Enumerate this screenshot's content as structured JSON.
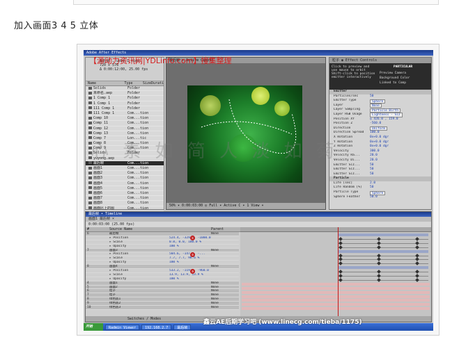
{
  "page": {
    "heading": "加入画面3 4 5 立体"
  },
  "app": {
    "window_title": "Adobe After Effects",
    "watermark_top": "【源动力资讯网|YDLinfo.com】搜集整理",
    "watermark_center": "心 素 如 简  人 淡 如 菊",
    "watermark_bottom": "鑫云AE后期学习吧 (www.linecg.com/tieba/1175)"
  },
  "project": {
    "info_lines": [
      "最后帧 , used 1 time",
      "720 x 576",
      "Δ 0:00:12:00, 25.00 fps"
    ],
    "columns": [
      "Name",
      "Type",
      "Size",
      "Durati"
    ],
    "items": [
      {
        "name": "Solids",
        "type": "Folder"
      },
      {
        "name": "未命名.aep",
        "type": "Folder"
      },
      {
        "name": "1 Comp 1",
        "type": "Folder"
      },
      {
        "name": "1 Comp 1",
        "type": "Folder"
      },
      {
        "name": "111 Comp 1",
        "type": "Folder"
      },
      {
        "name": "111 Comp 1",
        "type": "Com...tion"
      },
      {
        "name": "Comp 10",
        "type": "Com...tion"
      },
      {
        "name": "Comp 11",
        "type": "Com...tion"
      },
      {
        "name": "Comp 12",
        "type": "Com...tion"
      },
      {
        "name": "Comp 13",
        "type": "Com...tion"
      },
      {
        "name": "Comp 7",
        "type": "Lon...tic"
      },
      {
        "name": "Comp 8",
        "type": "Com...tion"
      },
      {
        "name": "Comp 9",
        "type": "Com...tion"
      },
      {
        "name": "Solids",
        "type": "Folder"
      },
      {
        "name": "yuyong.aep",
        "type": ""
      },
      {
        "name": "最后帧",
        "type": "Com...tion",
        "selected": true
      },
      {
        "name": "画面1",
        "type": "Com...tion"
      },
      {
        "name": "画面2",
        "type": "Com...tion"
      },
      {
        "name": "画面3",
        "type": "Com...tion"
      },
      {
        "name": "画面4",
        "type": "Com...tion"
      },
      {
        "name": "画面5",
        "type": "Com...tion"
      },
      {
        "name": "画面6",
        "type": "Com...tion"
      },
      {
        "name": "画面7",
        "type": "Com...tion"
      },
      {
        "name": "画面8",
        "type": "Com...tion"
      },
      {
        "name": "画面比上的图",
        "type": "Com...tion"
      },
      {
        "name": "绿色...bar4459",
        "type": "Vid...avis"
      }
    ]
  },
  "composition": {
    "tab": "最后帧 × Active Camera",
    "footer": "50%  ▾  0:00:03:00  ◎  Full  ▾  Active C  ▾  1 View  ▾"
  },
  "effect_controls": {
    "tab": "粒子  ◉ Effect Controls",
    "banner_text": [
      "Click to preview and",
      "use mouse to orbit",
      "Shift-click to position",
      "emitter interactively"
    ],
    "banner_options": [
      "Preview Camera",
      "Background Color",
      "Linked to Comp"
    ],
    "brand": "PARTICULAR",
    "sections": [
      {
        "label": "Emitter",
        "section": true
      },
      {
        "label": "Particles/sec",
        "value": "50"
      },
      {
        "label": "Emitter Type",
        "value": "Sphere",
        "box": true
      },
      {
        "label": "Layer",
        "value": "None",
        "box": true
      },
      {
        "label": "Layer Sampling",
        "value": "Particle Birth",
        "box": true
      },
      {
        "label": "Layer RGB Usage",
        "value": "Lightness - Siz",
        "box": true
      },
      {
        "label": "Position XY",
        "value": "◎ 426.0 , 159.0"
      },
      {
        "label": "Position Z",
        "value": "-560.0"
      },
      {
        "label": "Direction",
        "value": "Uniform",
        "box": true
      },
      {
        "label": "Direction Spread",
        "value": "100.0"
      },
      {
        "label": "X Rotation",
        "value": "0x+0.0 dgr"
      },
      {
        "label": "Y Rotation",
        "value": "0x+0.0 dgr"
      },
      {
        "label": "Z Rotation",
        "value": "0x+0.0 dgr"
      },
      {
        "label": "Velocity",
        "value": "300.0"
      },
      {
        "label": "Velocity Ra...",
        "value": "20.0"
      },
      {
        "label": "Velocity Di...",
        "value": "20.0"
      },
      {
        "label": "Emitter Siz...",
        "value": "50"
      },
      {
        "label": "Emitter Siz...",
        "value": "50"
      },
      {
        "label": "Emitter Siz...",
        "value": "50"
      },
      {
        "label": "Particle",
        "section": true
      },
      {
        "label": "Life [sec]",
        "value": "2.0"
      },
      {
        "label": "Life Random [%]",
        "value": "50"
      },
      {
        "label": "Particle Type",
        "value": "Sphere",
        "box": true
      },
      {
        "label": "Sphere Feather",
        "value": "50.0"
      }
    ]
  },
  "timeline": {
    "title": "最后帧 • Timeline",
    "tabs": "画面1  最后帧 ×",
    "time_display": "0:00:03:00 (25.00 fps)",
    "columns": [
      "#",
      "Source Name",
      "",
      "Parent"
    ],
    "rows": [
      {
        "idx": "6",
        "src": "最后帧",
        "val": "",
        "par": "None",
        "layer": true
      },
      {
        "idx": "",
        "src": "▸ Position",
        "val": "524.4, -329.0, -1000.0",
        "par": ""
      },
      {
        "idx": "",
        "src": "▸ Scale",
        "val": "0.0, 0.0, 100.0 %",
        "par": ""
      },
      {
        "idx": "",
        "src": "▸ Opacity",
        "val": "100 %",
        "par": ""
      },
      {
        "idx": "7",
        "src": "画面3",
        "val": "",
        "par": "None",
        "layer": true
      },
      {
        "idx": "",
        "src": "▸ Position",
        "val": "504.6, -147.1, -...",
        "par": ""
      },
      {
        "idx": "",
        "src": "▸ Scale",
        "val": "7.7, 7.7, 98.6 %",
        "par": ""
      },
      {
        "idx": "",
        "src": "▸ Opacity",
        "val": "100 %",
        "par": ""
      },
      {
        "idx": "8",
        "src": "画面4",
        "val": "",
        "par": "None",
        "layer": true
      },
      {
        "idx": "",
        "src": "▸ Position",
        "val": "533.2, -119.5, -960.0",
        "par": ""
      },
      {
        "idx": "",
        "src": "▸ Scale",
        "val": "13.9, 13.9, 13.9 %",
        "par": ""
      },
      {
        "idx": "",
        "src": "▸ Opacity",
        "val": "100 %",
        "par": ""
      },
      {
        "idx": "4",
        "src": "画面1",
        "val": "",
        "par": "None",
        "layer": true
      },
      {
        "idx": "5",
        "src": "画面2",
        "val": "",
        "par": "None",
        "layer": true
      },
      {
        "idx": "6",
        "src": "粒子",
        "val": "",
        "par": "None",
        "layer": true
      },
      {
        "idx": "7",
        "src": "粒子",
        "val": "",
        "par": "None",
        "layer": true
      },
      {
        "idx": "8",
        "src": "绿色底1",
        "val": "",
        "par": "None",
        "layer": true
      },
      {
        "idx": "9",
        "src": "绿色底2",
        "val": "",
        "par": "None",
        "layer": true
      },
      {
        "idx": "10",
        "src": "绿色底3",
        "val": "",
        "par": "None",
        "layer": true
      }
    ],
    "footer": "Switches / Modes",
    "marker_labels": [
      "①",
      "②",
      "③"
    ]
  },
  "taskbar": {
    "start": "开始",
    "tasks": [
      "Radmin Viewer",
      "192.168.2.7",
      "最后帧"
    ]
  },
  "colors": {
    "watermark_red": "#d41c1c",
    "title_blue": "#1a3a8a",
    "value_blue": "#1a3fb0",
    "comp_green": "#1d7f2a"
  }
}
